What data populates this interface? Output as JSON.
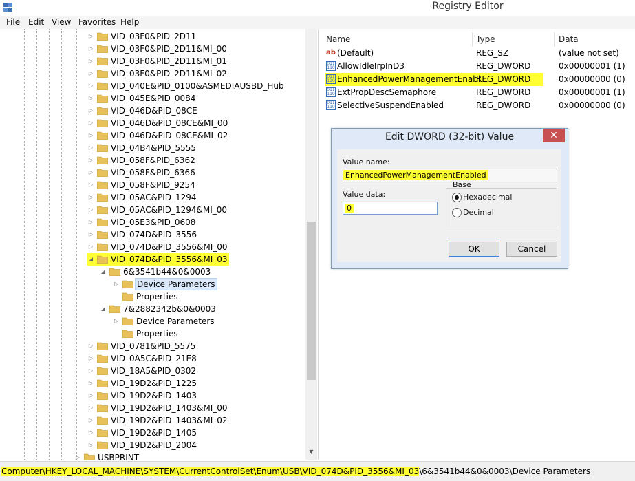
{
  "window": {
    "title": "Registry Editor"
  },
  "menu": [
    "File",
    "Edit",
    "View",
    "Favorites",
    "Help"
  ],
  "tree": {
    "items": [
      {
        "label": "VID_03F0&PID_2D11",
        "level": 0,
        "expander": "closed"
      },
      {
        "label": "VID_03F0&PID_2D11&MI_00",
        "level": 0,
        "expander": "closed"
      },
      {
        "label": "VID_03F0&PID_2D11&MI_01",
        "level": 0,
        "expander": "closed"
      },
      {
        "label": "VID_03F0&PID_2D11&MI_02",
        "level": 0,
        "expander": "closed"
      },
      {
        "label": "VID_040E&PID_0100&ASMEDIAUSBD_Hub",
        "level": 0,
        "expander": "closed"
      },
      {
        "label": "VID_045E&PID_0084",
        "level": 0,
        "expander": "closed"
      },
      {
        "label": "VID_046D&PID_08CE",
        "level": 0,
        "expander": "closed"
      },
      {
        "label": "VID_046D&PID_08CE&MI_00",
        "level": 0,
        "expander": "closed"
      },
      {
        "label": "VID_046D&PID_08CE&MI_02",
        "level": 0,
        "expander": "closed"
      },
      {
        "label": "VID_04B4&PID_5555",
        "level": 0,
        "expander": "closed"
      },
      {
        "label": "VID_058F&PID_6362",
        "level": 0,
        "expander": "closed"
      },
      {
        "label": "VID_058F&PID_6366",
        "level": 0,
        "expander": "closed"
      },
      {
        "label": "VID_058F&PID_9254",
        "level": 0,
        "expander": "closed"
      },
      {
        "label": "VID_05AC&PID_1294",
        "level": 0,
        "expander": "closed"
      },
      {
        "label": "VID_05AC&PID_1294&MI_00",
        "level": 0,
        "expander": "closed"
      },
      {
        "label": "VID_05E3&PID_0608",
        "level": 0,
        "expander": "closed"
      },
      {
        "label": "VID_074D&PID_3556",
        "level": 0,
        "expander": "closed"
      },
      {
        "label": "VID_074D&PID_3556&MI_00",
        "level": 0,
        "expander": "closed"
      },
      {
        "label": "VID_074D&PID_3556&MI_03",
        "level": 0,
        "expander": "open",
        "highlight": true
      },
      {
        "label": "6&3541b44&0&0003",
        "level": 1,
        "expander": "open"
      },
      {
        "label": "Device Parameters",
        "level": 2,
        "expander": "closed",
        "selected": true
      },
      {
        "label": "Properties",
        "level": 2,
        "expander": "none"
      },
      {
        "label": "7&2882342b&0&0003",
        "level": 1,
        "expander": "open"
      },
      {
        "label": "Device Parameters",
        "level": 2,
        "expander": "closed"
      },
      {
        "label": "Properties",
        "level": 2,
        "expander": "none"
      },
      {
        "label": "VID_0781&PID_5575",
        "level": 0,
        "expander": "closed"
      },
      {
        "label": "VID_0A5C&PID_21E8",
        "level": 0,
        "expander": "closed"
      },
      {
        "label": "VID_18A5&PID_0302",
        "level": 0,
        "expander": "closed"
      },
      {
        "label": "VID_19D2&PID_1225",
        "level": 0,
        "expander": "closed"
      },
      {
        "label": "VID_19D2&PID_1403",
        "level": 0,
        "expander": "closed"
      },
      {
        "label": "VID_19D2&PID_1403&MI_00",
        "level": 0,
        "expander": "closed"
      },
      {
        "label": "VID_19D2&PID_1403&MI_02",
        "level": 0,
        "expander": "closed"
      },
      {
        "label": "VID_19D2&PID_1405",
        "level": 0,
        "expander": "closed"
      },
      {
        "label": "VID_19D2&PID_2004",
        "level": 0,
        "expander": "closed"
      },
      {
        "label": "USBPRINT",
        "level": -1,
        "expander": "closed"
      }
    ]
  },
  "values": {
    "headers": {
      "name": "Name",
      "type": "Type",
      "data": "Data"
    },
    "rows": [
      {
        "name": "(Default)",
        "type": "REG_SZ",
        "data": "(value not set)",
        "icon": "ab"
      },
      {
        "name": "AllowIdleIrpInD3",
        "type": "REG_DWORD",
        "data": "0x00000001 (1)",
        "icon": "bin"
      },
      {
        "name": "EnhancedPowerManagementEnabl...",
        "type": "REG_DWORD",
        "data": "0x00000000 (0)",
        "icon": "bin",
        "highlight": true
      },
      {
        "name": "ExtPropDescSemaphore",
        "type": "REG_DWORD",
        "data": "0x00000001 (1)",
        "icon": "bin"
      },
      {
        "name": "SelectiveSuspendEnabled",
        "type": "REG_DWORD",
        "data": "0x00000000 (0)",
        "icon": "bin"
      }
    ]
  },
  "dialog": {
    "title": "Edit DWORD (32-bit) Value",
    "close": "✕",
    "value_name_label": "Value name:",
    "value_name": "EnhancedPowerManagementEnabled",
    "value_data_label": "Value data:",
    "value_data": "0",
    "base_label": "Base",
    "hex_label": "Hexadecimal",
    "dec_label": "Decimal",
    "base_selected": "Hexadecimal",
    "ok": "OK",
    "cancel": "Cancel"
  },
  "status": {
    "path_highlighted": "Computer\\HKEY_LOCAL_MACHINE\\SYSTEM\\CurrentControlSet\\Enum\\USB\\VID_074D&PID_3556&MI_03",
    "path_rest": "\\6&3541b44&0&0003\\Device Parameters"
  },
  "colors": {
    "highlight": "#ffff33",
    "folder": "#e8c15a",
    "selection": "#d9e8fb",
    "close_button": "#c75050"
  }
}
